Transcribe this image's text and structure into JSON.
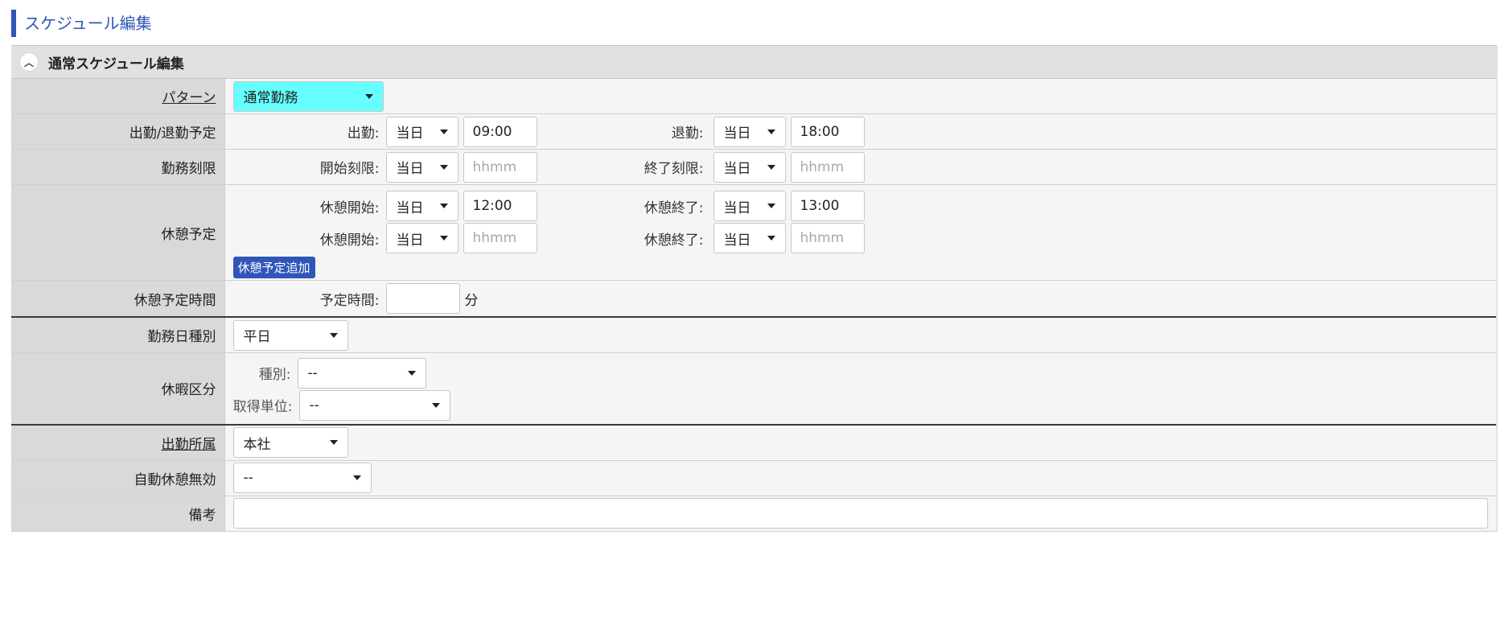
{
  "page_title": "スケジュール編集",
  "section": {
    "title": "通常スケジュール編集",
    "collapse_icon": "chevron-up-icon"
  },
  "pattern": {
    "label": "パターン",
    "value": "通常勤務",
    "bg": "#66ffff"
  },
  "commute": {
    "label": "出勤/退勤予定",
    "start_caption": "出勤:",
    "start_day": "当日",
    "start_time": "09:00",
    "end_caption": "退勤:",
    "end_day": "当日",
    "end_time": "18:00"
  },
  "work_limit": {
    "label": "勤務刻限",
    "start_caption": "開始刻限:",
    "start_day": "当日",
    "start_placeholder": "hhmm",
    "end_caption": "終了刻限:",
    "end_day": "当日",
    "end_placeholder": "hhmm"
  },
  "break_plan": {
    "label": "休憩予定",
    "rows": [
      {
        "start_caption": "休憩開始:",
        "start_day": "当日",
        "start_time": "12:00",
        "end_caption": "休憩終了:",
        "end_day": "当日",
        "end_time": "13:00"
      },
      {
        "start_caption": "休憩開始:",
        "start_day": "当日",
        "start_placeholder": "hhmm",
        "end_caption": "休憩終了:",
        "end_day": "当日",
        "end_placeholder": "hhmm"
      }
    ],
    "add_button": "休憩予定追加"
  },
  "break_time": {
    "label": "休憩予定時間",
    "caption": "予定時間:",
    "value": "",
    "unit": "分"
  },
  "work_day_type": {
    "label": "勤務日種別",
    "value": "平日"
  },
  "leave": {
    "label": "休暇区分",
    "type_caption": "種別:",
    "type_value": "--",
    "unit_caption": "取得単位:",
    "unit_value": "--"
  },
  "office": {
    "label": "出勤所属",
    "value": "本社"
  },
  "auto_break": {
    "label": "自動休憩無効",
    "value": "--"
  },
  "remarks": {
    "label": "備考",
    "value": ""
  },
  "colors": {
    "accent": "#2f56b8",
    "label_bg": "#d9d9d9",
    "value_bg": "#f5f5f5"
  }
}
